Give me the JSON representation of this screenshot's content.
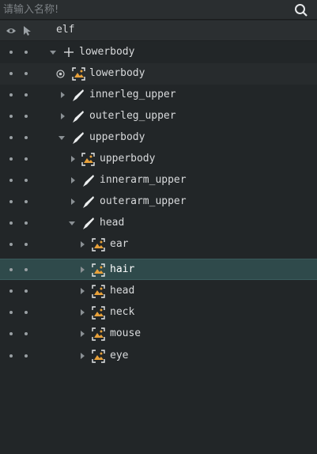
{
  "search": {
    "placeholder": "请输入名称!"
  },
  "header": {
    "root_label": "elf"
  },
  "rows": [
    {
      "label": "lowerbody"
    },
    {
      "label": "lowerbody"
    },
    {
      "label": "innerleg_upper"
    },
    {
      "label": "outerleg_upper"
    },
    {
      "label": "upperbody"
    },
    {
      "label": "upperbody"
    },
    {
      "label": "innerarm_upper"
    },
    {
      "label": "outerarm_upper"
    },
    {
      "label": "head"
    },
    {
      "label": "ear"
    },
    {
      "label": "hair"
    },
    {
      "label": "head"
    },
    {
      "label": "neck"
    },
    {
      "label": "mouse"
    },
    {
      "label": "eye"
    }
  ],
  "colors": {
    "selected_row": "#2f4a4b",
    "background": "#222628",
    "image_icon_accent": "#e8a13a"
  }
}
